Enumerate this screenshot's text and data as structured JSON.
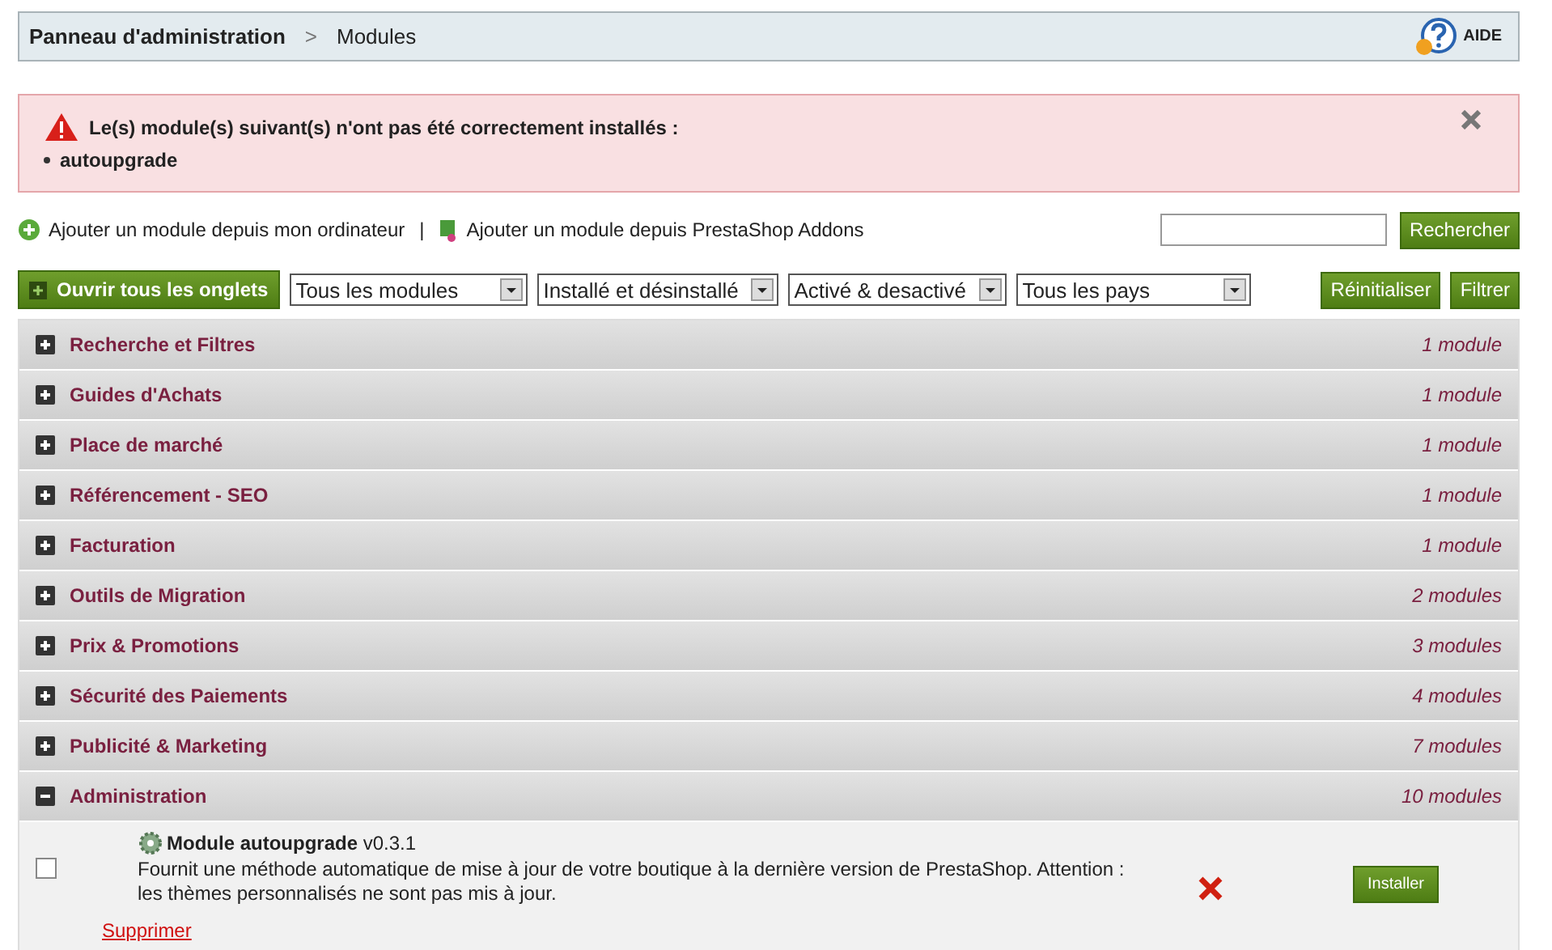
{
  "breadcrumb": {
    "root": "Panneau d'administration",
    "separator": ">",
    "current": "Modules",
    "help": "AIDE"
  },
  "error": {
    "message": "Le(s) module(s) suivant(s) n'ont pas été correctement installés :",
    "items": [
      "autoupgrade"
    ]
  },
  "add_links": [
    {
      "kind": "computer",
      "label": "Ajouter un module depuis mon ordinateur"
    },
    {
      "kind": "addons",
      "label": "Ajouter un module depuis PrestaShop Addons"
    }
  ],
  "link_separator": "|",
  "search": {
    "button": "Rechercher"
  },
  "toolbar": {
    "open_all": "Ouvrir tous les onglets",
    "filters": [
      "Tous les modules",
      "Installé et désinstallé",
      "Activé & desactivé",
      "Tous les pays"
    ],
    "reset": "Réinitialiser",
    "filter": "Filtrer"
  },
  "categories": [
    {
      "name": "Recherche et Filtres",
      "count": "1 module",
      "expanded": false
    },
    {
      "name": "Guides d'Achats",
      "count": "1 module",
      "expanded": false
    },
    {
      "name": "Place de marché",
      "count": "1 module",
      "expanded": false
    },
    {
      "name": "Référencement - SEO",
      "count": "1 module",
      "expanded": false
    },
    {
      "name": "Facturation",
      "count": "1 module",
      "expanded": false
    },
    {
      "name": "Outils de Migration",
      "count": "2 modules",
      "expanded": false
    },
    {
      "name": "Prix & Promotions",
      "count": "3 modules",
      "expanded": false
    },
    {
      "name": "Sécurité des Paiements",
      "count": "4 modules",
      "expanded": false
    },
    {
      "name": "Publicité & Marketing",
      "count": "7 modules",
      "expanded": false
    },
    {
      "name": "Administration",
      "count": "10 modules",
      "expanded": true,
      "modules": [
        {
          "title": "Module autoupgrade",
          "version": "v0.3.1",
          "checked": false,
          "description": "Fournit une méthode automatique de mise à jour de votre boutique à la dernière version de PrestaShop. Attention : les thèmes personnalisés ne sont pas mis à jour.",
          "installed": false,
          "install": "Installer",
          "delete": "Supprimer"
        }
      ]
    }
  ]
}
